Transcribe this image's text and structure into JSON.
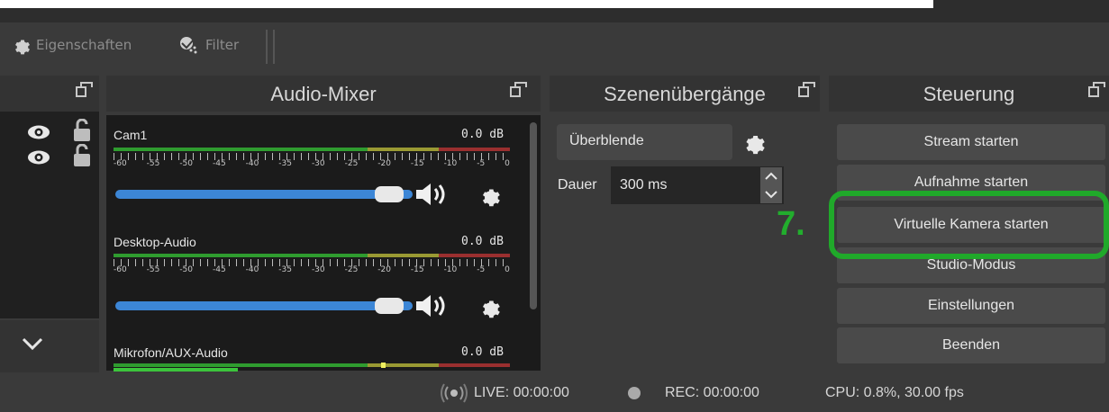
{
  "toolbar": {
    "properties_label": "Eigenschaften",
    "filter_label": "Filter"
  },
  "audio_mixer": {
    "title": "Audio-Mixer",
    "scale_labels": [
      "-60",
      "-55",
      "-50",
      "-45",
      "-40",
      "-35",
      "-30",
      "-25",
      "-20",
      "-15",
      "-10",
      "-5",
      "0"
    ],
    "channels": [
      {
        "name": "Cam1",
        "level": "0.0 dB"
      },
      {
        "name": "Desktop-Audio",
        "level": "0.0 dB"
      },
      {
        "name": "Mikrofon/AUX-Audio",
        "level": "0.0 dB"
      }
    ]
  },
  "transitions": {
    "title": "Szenenübergänge",
    "selected": "Überblende",
    "duration_label": "Dauer",
    "duration_value": "300 ms"
  },
  "controls": {
    "title": "Steuerung",
    "buttons": [
      "Stream starten",
      "Aufnahme starten",
      "Virtuelle Kamera starten",
      "Studio-Modus",
      "Einstellungen",
      "Beenden"
    ]
  },
  "annotation": {
    "step": "7.",
    "color": "#20a92a"
  },
  "status": {
    "live": "LIVE: 00:00:00",
    "rec": "REC: 00:00:00",
    "cpu": "CPU: 0.8%, 30.00 fps"
  }
}
